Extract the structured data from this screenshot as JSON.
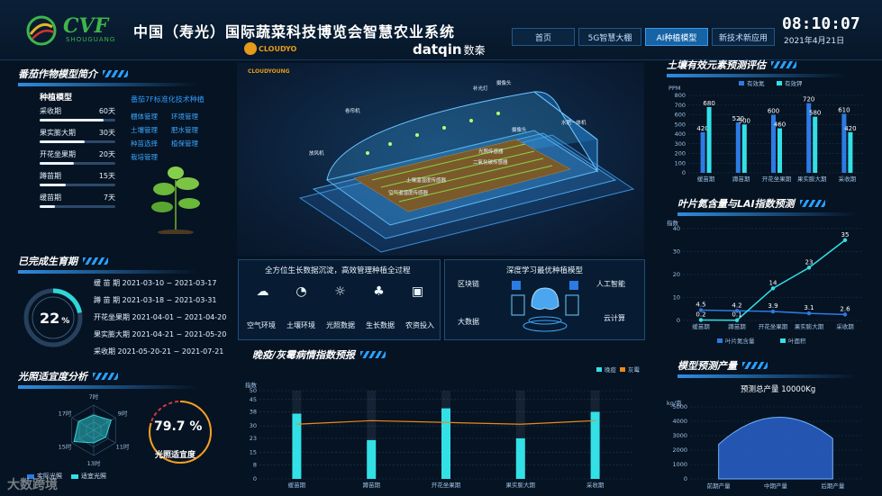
{
  "header": {
    "brand": "CVF",
    "brand_sub": "SHOUGUANG",
    "title": "中国（寿光）国际蔬菜科技博览会智慧农业系统",
    "partner1_name": "CLOUDYOUNG",
    "partner2_name": "datqin",
    "partner2_cn": "数秦",
    "tabs": [
      {
        "label": "首页",
        "active": false
      },
      {
        "label": "5G智慧大棚",
        "active": false
      },
      {
        "label": "AI种植模型",
        "active": true
      },
      {
        "label": "新技术新应用",
        "active": false
      }
    ],
    "time": "08:10:07",
    "date": "2021年4月21日"
  },
  "crop": {
    "title": "番茄作物模型简介",
    "model_label": "种植模型",
    "stages": [
      {
        "name": "采收期",
        "days": "60天",
        "fill": 0.85
      },
      {
        "name": "果实膨大期",
        "days": "30天",
        "fill": 0.6
      },
      {
        "name": "开花坐果期",
        "days": "20天",
        "fill": 0.45
      },
      {
        "name": "蹲苗期",
        "days": "15天",
        "fill": 0.35
      },
      {
        "name": "缓苗期",
        "days": "7天",
        "fill": 0.2
      }
    ],
    "standard_title": "番茄7F标准化技术种植",
    "standard_items": [
      "棚体管理",
      "环境管理",
      "土壤管理",
      "肥水管理",
      "种苗选择",
      "植保管理",
      "栽培管理"
    ]
  },
  "growth": {
    "title": "已完成生育期",
    "percent": "22",
    "percent_unit": "%",
    "percent_value": 22,
    "periods": [
      {
        "name": "缓 苗 期",
        "range": "2021-03-10 ~ 2021-03-17"
      },
      {
        "name": "蹲 苗 期",
        "range": "2021-03-18 ~ 2021-03-31"
      },
      {
        "name": "开花坐果期",
        "range": "2021-04-01 ~ 2021-04-20"
      },
      {
        "name": "果实膨大期",
        "range": "2021-04-21 ~ 2021-05-20"
      },
      {
        "name": "采收期",
        "range": "2021-05-20-21 ~ 2021-07-21"
      }
    ]
  },
  "light": {
    "title": "光照适宜度分析",
    "radar_labels": [
      "7时",
      "9时",
      "11时",
      "13时",
      "15时",
      "17时"
    ],
    "gauge_value": "79.7 %",
    "gauge_fraction": 0.797,
    "gauge_label": "光照适宜度",
    "legend": [
      "实际光照",
      "适宜光照"
    ]
  },
  "greenhouse": {
    "labels": [
      "摄像头",
      "补光灯",
      "卷帘机",
      "放风机",
      "水肥一体机",
      "光照传感器",
      "二氧化碳传感器",
      "摄像头",
      "土壤温湿度传感器",
      "空气温湿度传感器"
    ]
  },
  "data_panel": {
    "title": "全方位生长数据沉淀，高效管理种植全过程",
    "items": [
      {
        "label": "空气环境",
        "icon": "cloud-icon"
      },
      {
        "label": "土壤环境",
        "icon": "soil-icon"
      },
      {
        "label": "光照数据",
        "icon": "sun-icon"
      },
      {
        "label": "生长数据",
        "icon": "sprout-icon"
      },
      {
        "label": "农资投入",
        "icon": "supplies-icon"
      }
    ]
  },
  "deep_panel": {
    "title": "深度学习最优种植模型",
    "left": [
      "区块链",
      "大数据"
    ],
    "right": [
      "人工智能",
      "云计算"
    ]
  },
  "soil_chart": {
    "title": "土壤有效元素预测评估",
    "unit": "PPM",
    "legend": [
      "有效氮",
      "有效钾"
    ],
    "colors": [
      "#2c7be5",
      "#32e0e6"
    ],
    "chart_data": {
      "type": "bar",
      "categories": [
        "缓苗期",
        "蹲苗期",
        "开花坐果期",
        "果实膨大期",
        "采收期"
      ],
      "series": [
        {
          "name": "有效氮",
          "values": [
            420,
            520,
            600,
            720,
            610
          ]
        },
        {
          "name": "有效钾",
          "values": [
            680,
            500,
            460,
            580,
            420
          ]
        }
      ],
      "yticks": [
        0,
        100,
        200,
        300,
        400,
        500,
        600,
        700,
        800
      ],
      "ylim": [
        0,
        800
      ]
    }
  },
  "lai_chart": {
    "title": "叶片氮含量与LAI指数预测",
    "unit": "指数",
    "legend": [
      "叶片氮含量",
      "叶面积"
    ],
    "colors": [
      "#2c7be5",
      "#32e0e6"
    ],
    "chart_data": {
      "type": "line",
      "categories": [
        "缓苗期",
        "蹲苗期",
        "开花坐果期",
        "果实膨大期",
        "采收期"
      ],
      "series": [
        {
          "name": "叶片氮含量",
          "values": [
            4.5,
            4.2,
            3.9,
            3.1,
            2.6
          ]
        },
        {
          "name": "叶面积",
          "values": [
            0.2,
            0.1,
            14,
            23,
            35
          ]
        }
      ],
      "yticks": [
        0,
        10,
        20,
        30,
        40
      ],
      "ylim": [
        0,
        40
      ]
    }
  },
  "disease_chart": {
    "title": "晚疫/灰霉病情指数预报",
    "unit": "指数",
    "legend": [
      "晚疫",
      "灰霉"
    ],
    "colors": [
      "#32e0e6",
      "#e98a1b"
    ],
    "chart_data": {
      "type": "bar",
      "categories": [
        "缓苗期",
        "蹲苗期",
        "开花坐果期",
        "果实膨大期",
        "采收期"
      ],
      "series": [
        {
          "name": "晚疫",
          "values": [
            37,
            22,
            40,
            23,
            38
          ]
        },
        {
          "name": "灰霉",
          "values": [
            31,
            33,
            32,
            31,
            33
          ]
        }
      ],
      "yticks": [
        0,
        8,
        15,
        23,
        30,
        38,
        45,
        50
      ],
      "ylim": [
        0,
        50
      ]
    }
  },
  "yield_chart": {
    "title": "模型预测产量",
    "total": "预测总产量 10000Kg",
    "unit": "kg/亩",
    "chart_data": {
      "type": "area",
      "categories": [
        "前期产量",
        "中期产量",
        "后期产量"
      ],
      "values": [
        2400,
        4700,
        2800
      ],
      "yticks": [
        0,
        1000,
        2000,
        3000,
        4000,
        5000
      ],
      "ylim": [
        0,
        5000
      ]
    }
  },
  "watermark": "大数跨境"
}
